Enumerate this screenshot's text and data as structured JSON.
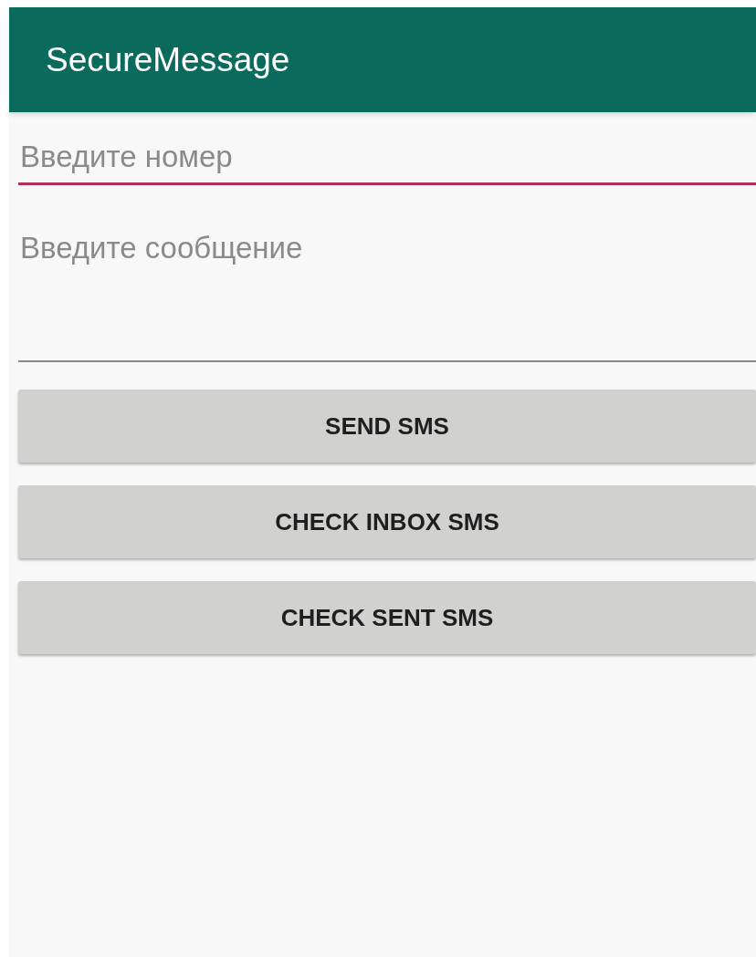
{
  "app_bar": {
    "title": "SecureMessage"
  },
  "fields": [
    {
      "placeholder": "Введите номер",
      "focused": true,
      "multiline": false
    },
    {
      "placeholder": "Введите сообщение",
      "focused": false,
      "multiline": true
    }
  ],
  "buttons": [
    {
      "label": "SEND SMS"
    },
    {
      "label": "CHECK INBOX SMS"
    },
    {
      "label": "CHECK SENT SMS"
    }
  ]
}
